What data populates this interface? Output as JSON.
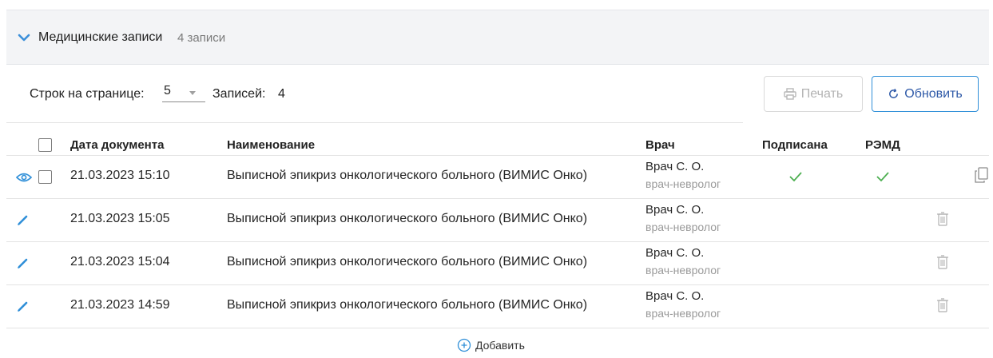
{
  "section": {
    "title": "Медицинские записи",
    "count_label": "4 записи"
  },
  "toolbar": {
    "rows_per_page_label": "Строк на странице:",
    "rows_per_page_value": "5",
    "total_label": "Записей:",
    "total_value": "4",
    "print_label": "Печать",
    "refresh_label": "Обновить"
  },
  "table": {
    "columns": {
      "date": "Дата документа",
      "name": "Наименование",
      "doctor": "Врач",
      "signed": "Подписана",
      "remd": "РЭМД"
    },
    "rows": [
      {
        "date": "21.03.2023 15:10",
        "name": "Выписной эпикриз онкологического больного (ВИМИС Онко)",
        "doctor": "Врач С. О.",
        "specialty": "врач-невролог",
        "signed": true,
        "remd": true,
        "action_icon": "eye-icon",
        "row_action": "copy-icon"
      },
      {
        "date": "21.03.2023 15:05",
        "name": "Выписной эпикриз онкологического больного (ВИМИС Онко)",
        "doctor": "Врач С. О.",
        "specialty": "врач-невролог",
        "signed": false,
        "remd": false,
        "action_icon": "pencil-icon",
        "row_action": "trash-icon"
      },
      {
        "date": "21.03.2023 15:04",
        "name": "Выписной эпикриз онкологического больного (ВИМИС Онко)",
        "doctor": "Врач С. О.",
        "specialty": "врач-невролог",
        "signed": false,
        "remd": false,
        "action_icon": "pencil-icon",
        "row_action": "trash-icon"
      },
      {
        "date": "21.03.2023 14:59",
        "name": "Выписной эпикриз онкологического больного (ВИМИС Онко)",
        "doctor": "Врач С. О.",
        "specialty": "врач-невролог",
        "signed": false,
        "remd": false,
        "action_icon": "pencil-icon",
        "row_action": "trash-icon"
      }
    ]
  },
  "footer": {
    "add_label": "Добавить"
  },
  "colors": {
    "accent_blue": "#2f8fd8",
    "check_green": "#4caf50",
    "muted_gray": "#9a9a9a"
  }
}
